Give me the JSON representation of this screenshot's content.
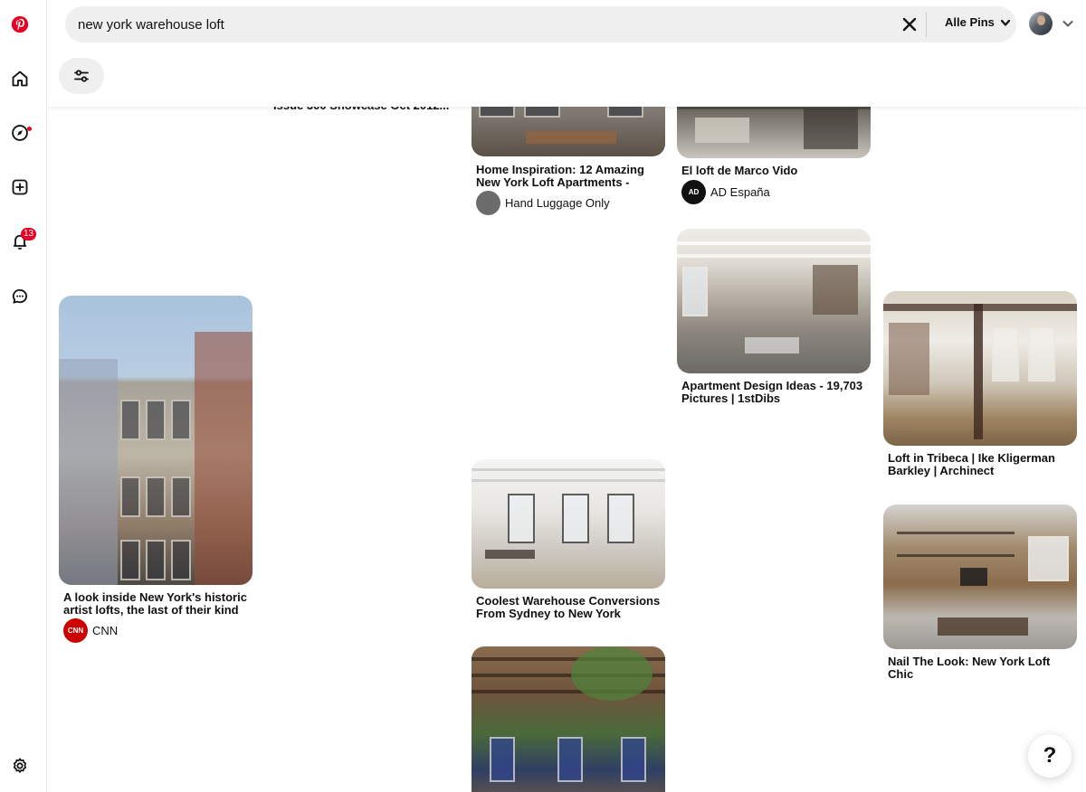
{
  "search": {
    "query": "new york warehouse loft",
    "scope_label": "Alle Pins"
  },
  "nav": {
    "notification_count": "13"
  },
  "pins": {
    "partial": {
      "title": "Issue 300 Showcase Oct 2012..."
    },
    "home_inspiration": {
      "title": "Home Inspiration: 12 Amazing New York Loft Apartments - Hand Luggage Only",
      "source": "Hand Luggage Only"
    },
    "marco_vido": {
      "title": "El loft de Marco Vido",
      "source": "AD España",
      "source_logo": "AD"
    },
    "design_ideas": {
      "title": "Apartment Design Ideas - 19,703 Pictures | 1stDibs"
    },
    "cnn": {
      "title": "A look inside New York's historic artist lofts, the last of their kind",
      "source": "CNN",
      "source_logo": "CNN"
    },
    "tribeca": {
      "title": "Loft in Tribeca | Ike Kligerman Barkley | Archinect"
    },
    "coolest": {
      "title": "Coolest Warehouse Conversions From Sydney to New York"
    },
    "nail_the_look": {
      "title": "Nail The Look: New York Loft Chic"
    }
  },
  "help": {
    "label": "?"
  },
  "colors": {
    "brand": "#e60023",
    "search_bg": "#efefef"
  },
  "icons": [
    "pinterest-logo-icon",
    "home-icon",
    "compass-icon",
    "plus-square-icon",
    "bell-icon",
    "chat-icon",
    "settings-icon",
    "clear-icon",
    "chevron-down-icon",
    "filter-icon",
    "help-icon"
  ]
}
